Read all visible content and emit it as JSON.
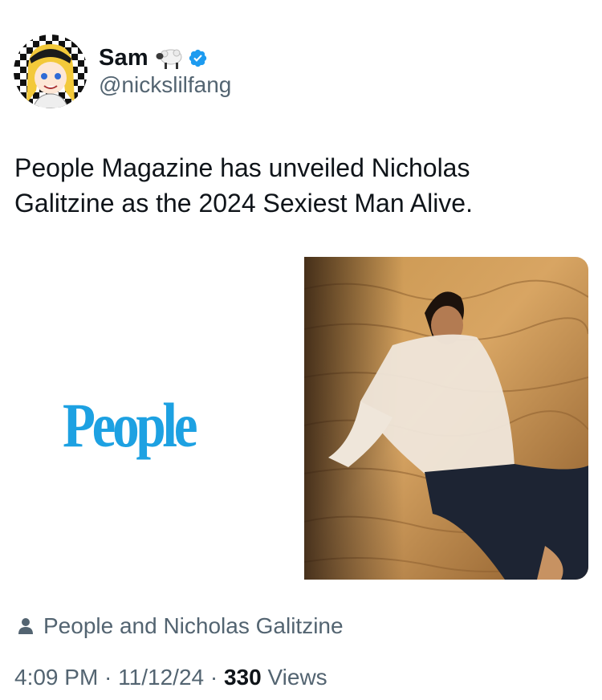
{
  "author": {
    "display_name": "Sam",
    "emoji_icon": "sheep-icon",
    "verified_icon": "verified-badge-icon",
    "handle": "@nickslilfang"
  },
  "tweet": {
    "text": "People Magazine has unveiled Nicholas Galitzine as the 2024 Sexiest Man Alive."
  },
  "media": {
    "logo_text": "People",
    "photo_description_icon": "photo-man-on-sand"
  },
  "tags": {
    "icon": "person-icon",
    "text": "People and Nicholas Galitzine"
  },
  "meta": {
    "time": "4:09 PM",
    "sep1": " · ",
    "date": "11/12/24",
    "sep2": " · ",
    "views_count": "330",
    "views_label": " Views"
  },
  "colors": {
    "text": "#0f1419",
    "secondary": "#536471",
    "verified": "#1d9bf0",
    "people_logo": "#1da1e2"
  }
}
